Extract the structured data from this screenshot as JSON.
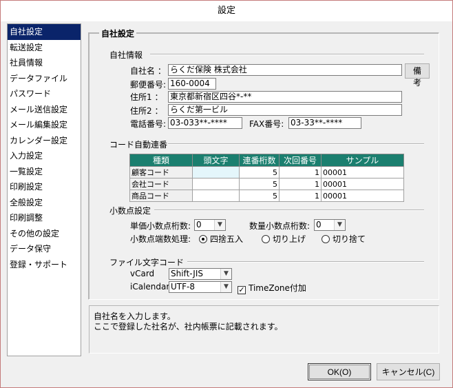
{
  "window": {
    "title": "設定"
  },
  "sidebar": {
    "items": [
      {
        "label": "自社設定",
        "selected": true
      },
      {
        "label": "転送設定"
      },
      {
        "label": "社員情報"
      },
      {
        "label": "データファイル"
      },
      {
        "label": "パスワード"
      },
      {
        "label": "メール送信設定"
      },
      {
        "label": "メール編集設定"
      },
      {
        "label": "カレンダー設定"
      },
      {
        "label": "入力設定"
      },
      {
        "label": "一覧設定"
      },
      {
        "label": "印刷設定"
      },
      {
        "label": "全般設定"
      },
      {
        "label": "印刷調整"
      },
      {
        "label": "その他の設定"
      },
      {
        "label": "データ保守"
      },
      {
        "label": "登録・サポート"
      }
    ]
  },
  "main": {
    "title": "自社設定",
    "company_info": {
      "section_label": "自社情報",
      "name_label": "自社名 ：",
      "name_value": "らくだ保険 株式会社",
      "memo_button": "備考",
      "postal_label": "郵便番号:",
      "postal_value": "160-0004",
      "address1_label": "住所1 ：",
      "address1_value": "東京都新宿区四谷*-**",
      "address2_label": "住所2 ：",
      "address2_value": "らくだ第一ビル",
      "phone_label": "電話番号:",
      "phone_value": "03-033**-****",
      "fax_label": "FAX番号:",
      "fax_value": "03-33**-****"
    },
    "auto_numbering": {
      "section_label": "コード自動連番",
      "columns": [
        "種類",
        "頭文字",
        "連番桁数",
        "次回番号",
        "サンプル"
      ],
      "rows": [
        {
          "type": "顧客コード",
          "prefix": "",
          "digits": "5",
          "next": "1",
          "sample": "00001"
        },
        {
          "type": "会社コード",
          "prefix": "",
          "digits": "5",
          "next": "1",
          "sample": "00001"
        },
        {
          "type": "商品コード",
          "prefix": "",
          "digits": "5",
          "next": "1",
          "sample": "00001"
        }
      ]
    },
    "decimal": {
      "section_label": "小数点設定",
      "unit_price_label": "単価小数点桁数:",
      "unit_price_value": "0",
      "quantity_label": "数量小数点桁数:",
      "quantity_value": "0",
      "rounding_label": "小数点端数処理:",
      "rounding_options": [
        "四捨五入",
        "切り上げ",
        "切り捨て"
      ],
      "rounding_selected": 0
    },
    "file_encoding": {
      "section_label": "ファイル文字コード",
      "vcard_label": "vCard",
      "vcard_value": "Shift-JIS",
      "ical_label": "iCalendar:",
      "ical_value": "UTF-8",
      "timezone_label": "TimeZone付加",
      "timezone_checked": true,
      "check_mark": "✓"
    }
  },
  "info": {
    "line1": "自社名を入力します。",
    "line2": "ここで登録した社名が、社内帳票に記載されます。"
  },
  "buttons": {
    "ok": "OK(O)",
    "cancel": "キャンセル(C)"
  }
}
